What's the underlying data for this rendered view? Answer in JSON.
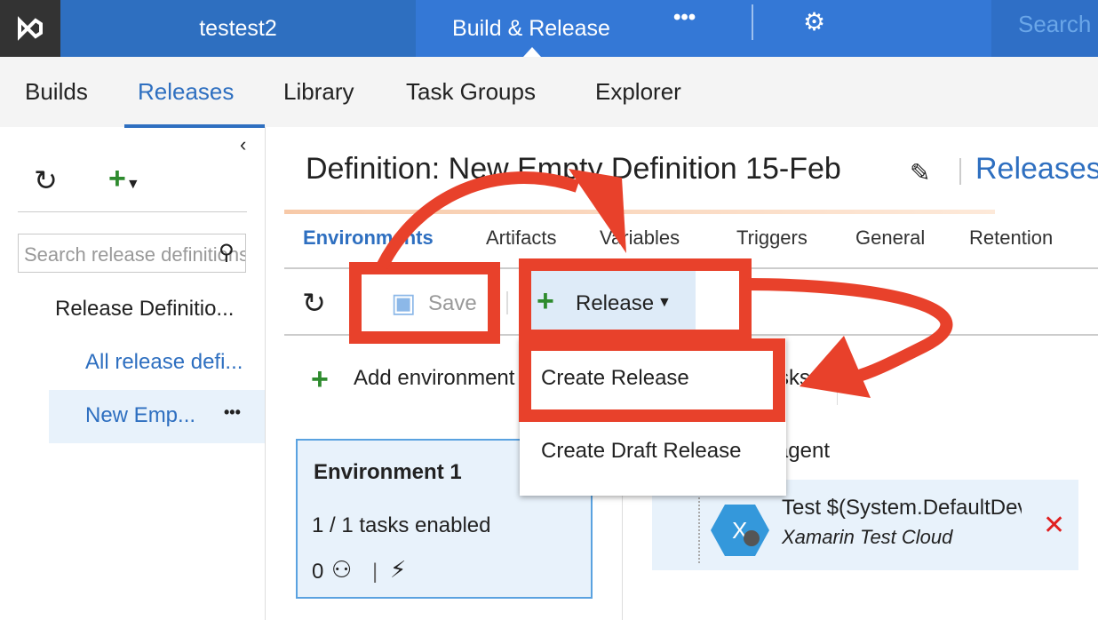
{
  "topbar": {
    "account": "testest2",
    "hub": "Build & Release",
    "more": "•••",
    "search_placeholder": "Search"
  },
  "subnav": {
    "items": [
      "Builds",
      "Releases",
      "Library",
      "Task Groups",
      "Explorer"
    ],
    "active": "Releases"
  },
  "left": {
    "collapse": "‹",
    "section": "Release Definitio...",
    "all": "All release defi...",
    "selected": "New Emp...",
    "more": "•••",
    "search_placeholder": "Search release definitions"
  },
  "header": {
    "title": "Definition: New Empty Definition 15-Feb",
    "link": "Releases"
  },
  "tabs": [
    "Environments",
    "Artifacts",
    "Variables",
    "Triggers",
    "General",
    "Retention"
  ],
  "toolbar": {
    "save": "Save",
    "release": "Release"
  },
  "menu": {
    "items": [
      "Create Release",
      "Create Draft Release"
    ]
  },
  "add_env": "Add environment",
  "environment": {
    "name": "Environment 1",
    "tasks": "1 / 1 tasks enabled",
    "approvers": "0"
  },
  "phase": {
    "label": "Run on agent",
    "tasks_label": "Tasks"
  },
  "task": {
    "title": "Test $(System.DefaultDevice)",
    "subtitle": "Xamarin Test Cloud"
  },
  "colors": {
    "accent": "#2e6fc0",
    "annotation": "#e8412b",
    "plus": "#2e8b2e",
    "remove": "#e02020"
  }
}
